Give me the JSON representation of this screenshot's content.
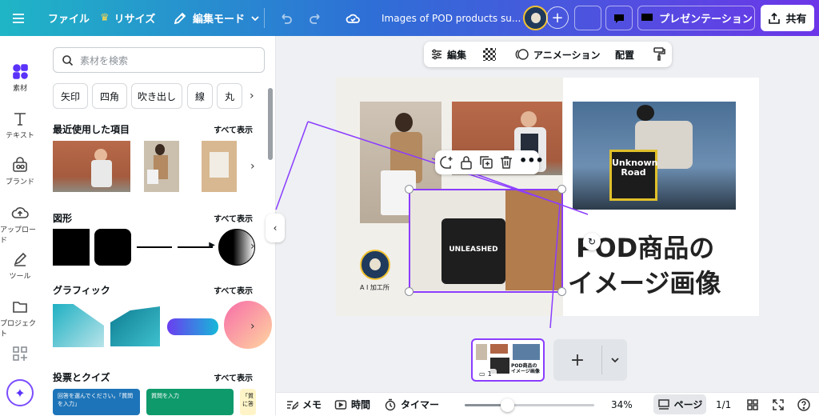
{
  "topbar": {
    "file": "ファイル",
    "resize": "リサイズ",
    "edit_mode": "編集モード",
    "doc_title": "Images of POD products su...",
    "present": "プレゼンテーション",
    "share": "共有"
  },
  "rail": {
    "items": [
      {
        "label": "素材"
      },
      {
        "label": "テキスト"
      },
      {
        "label": "ブランド"
      },
      {
        "label": "アップロード"
      },
      {
        "label": "ツール"
      },
      {
        "label": "プロジェクト"
      }
    ]
  },
  "panel": {
    "search_placeholder": "素材を検索",
    "chips": [
      "矢印",
      "四角",
      "吹き出し",
      "線",
      "丸"
    ],
    "recent": "最近使用した項目",
    "shapes": "図形",
    "graphics": "グラフィック",
    "quiz": "投票とクイズ",
    "see_all": "すべて表示",
    "quiz_card1": "回答を選んでください。「質問を入力」",
    "quiz_card2": "質問を入力",
    "quiz_card3": "「質に答"
  },
  "context_toolbar": {
    "edit": "編集",
    "animation": "アニメーション",
    "arrange": "配置"
  },
  "design": {
    "heading_line1": "POD商品の",
    "heading_line2": "イメージ画像",
    "logo_caption": "A I 加工所",
    "pillow_text": "UNLEASHED",
    "bag_text": "Unknown Road"
  },
  "thumbnail": {
    "page_number": "1",
    "caption": "POD商品の イメージ画像"
  },
  "bottombar": {
    "memo": "メモ",
    "time": "時間",
    "timer": "タイマー",
    "zoom": "34%",
    "page": "ページ",
    "page_count": "1/1"
  },
  "colors": {
    "accent": "#8b3dff",
    "topbar_start": "#1fb5c6",
    "topbar_end": "#6c36e8"
  }
}
